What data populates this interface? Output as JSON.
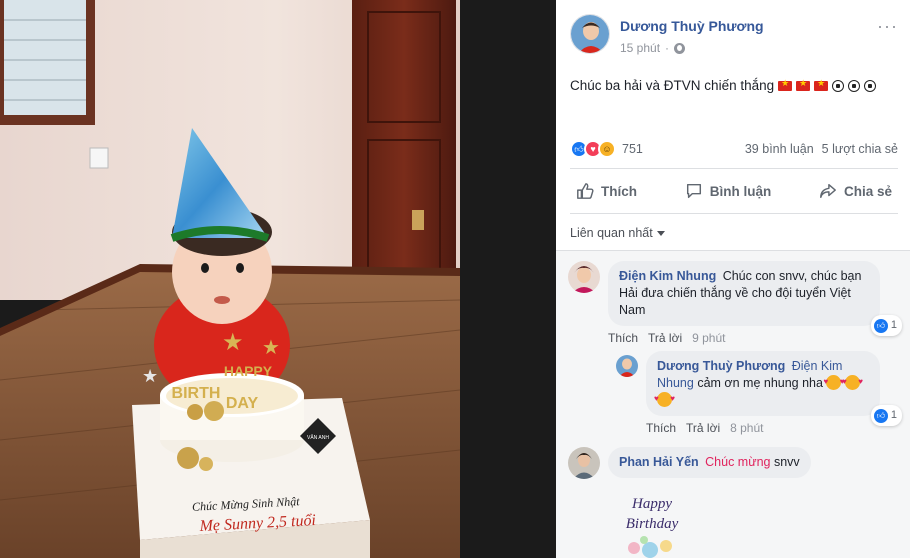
{
  "post": {
    "author": "Dương Thuỳ Phương",
    "time": "15 phút",
    "text": "Chúc ba hải và ĐTVN chiến thắng",
    "reaction_count": "751",
    "comments_count": "39 bình luận",
    "shares_count": "5 lượt chia sẻ"
  },
  "actions": {
    "like": "Thích",
    "comment": "Bình luận",
    "share": "Chia sẻ"
  },
  "sort_label": "Liên quan nhất",
  "comments": [
    {
      "name": "Điện Kim Nhung",
      "text": "Chúc con snvv, chúc bạn Hải đưa chiến thắng về cho đội tuyển Việt Nam",
      "like_label": "Thích",
      "reply_label": "Trả lời",
      "time": "9 phút",
      "likes": "1"
    },
    {
      "name": "Dương Thuỳ Phương",
      "tag": "Điện Kim Nhung",
      "text": "cảm ơn mẹ nhung nha",
      "like_label": "Thích",
      "reply_label": "Trả lời",
      "time": "8 phút",
      "likes": "1"
    },
    {
      "name": "Phan Hải Yến",
      "highlight": "Chúc mừng",
      "text": "snvv"
    }
  ],
  "photo": {
    "cake_lines": [
      "HAPPY",
      "BIRTH",
      "DAY"
    ],
    "board_line1": "Chúc Mừng Sinh Nhật",
    "board_line2": "Mẹ Sunny 2,5 tuổi",
    "badge": "VÂN ANH",
    "sticker_text": [
      "Happy",
      "Birthday"
    ]
  },
  "colors": {
    "link": "#365899",
    "like_blue": "#1877f2",
    "love_red": "#f33e58",
    "muted": "#90949c"
  }
}
